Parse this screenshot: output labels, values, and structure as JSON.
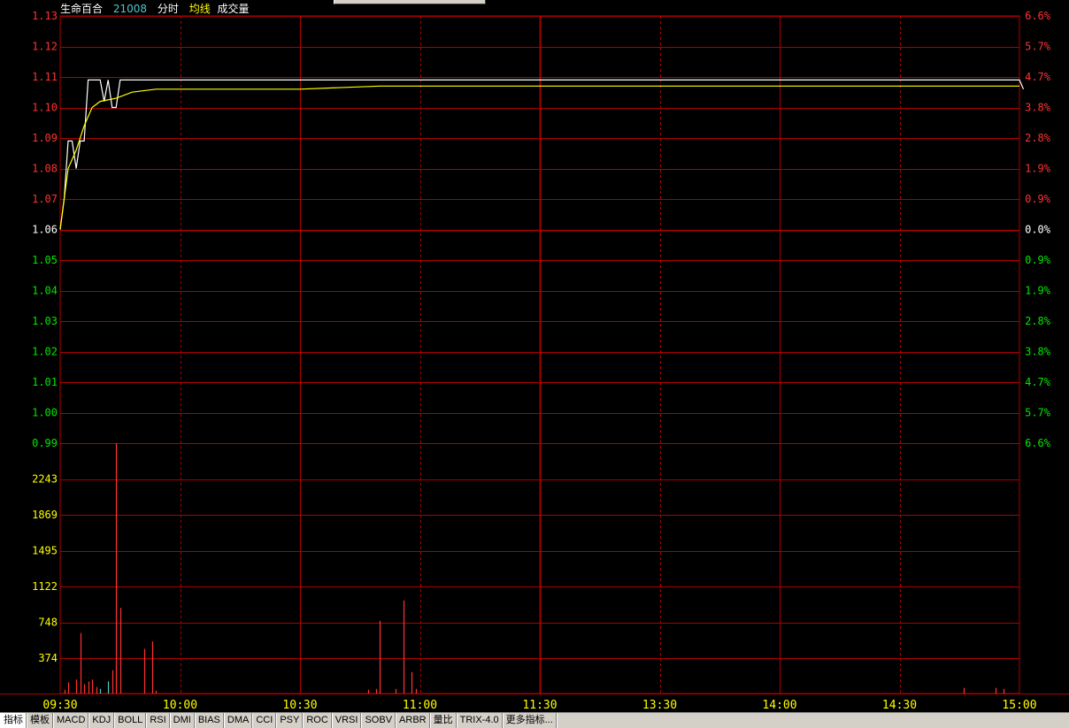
{
  "header": {
    "stock_name": "生命百合",
    "stock_code": "21008",
    "mode": "分时",
    "avg_label": "均线",
    "volume_label": "成交量"
  },
  "price_axis": {
    "labels": [
      "1.13",
      "1.12",
      "1.11",
      "1.10",
      "1.09",
      "1.08",
      "1.07",
      "1.06",
      "1.05",
      "1.04",
      "1.03",
      "1.02",
      "1.01",
      "1.00",
      "0.99"
    ],
    "base_price": 1.06,
    "min": 0.99,
    "max": 1.13
  },
  "pct_axis": {
    "labels": [
      "6.6%",
      "5.7%",
      "4.7%",
      "3.8%",
      "2.8%",
      "1.9%",
      "0.9%",
      "0.0%",
      "0.9%",
      "1.9%",
      "2.8%",
      "3.8%",
      "4.7%",
      "5.7%",
      "6.6%"
    ]
  },
  "volume_axis": {
    "labels": [
      "2243",
      "1869",
      "1495",
      "1122",
      "748",
      "374"
    ],
    "max": 2690
  },
  "time_axis": {
    "labels": [
      "09:30",
      "10:00",
      "10:30",
      "11:00",
      "11:30",
      "13:30",
      "14:00",
      "14:30",
      "15:00"
    ]
  },
  "colors": {
    "grid": "#b00000",
    "up": "#ff3232",
    "down": "#00e600",
    "flat": "#ffffff",
    "time_label": "#ffff00",
    "volume_label": "#ffff00",
    "price_line": "#ffffff",
    "avg_line": "#ffff00",
    "volume_up": "#ff3232",
    "volume_down": "#4ec9c9"
  },
  "chart_data": {
    "type": "line",
    "x_unit": "trading minutes since 09:30 (0-240)",
    "series": [
      {
        "name": "分时",
        "points": [
          [
            0,
            1.06
          ],
          [
            1,
            1.07
          ],
          [
            2,
            1.089
          ],
          [
            3,
            1.089
          ],
          [
            4,
            1.08
          ],
          [
            5,
            1.089
          ],
          [
            6,
            1.089
          ],
          [
            7,
            1.109
          ],
          [
            8,
            1.109
          ],
          [
            9,
            1.109
          ],
          [
            10,
            1.109
          ],
          [
            11,
            1.102
          ],
          [
            12,
            1.109
          ],
          [
            13,
            1.1
          ],
          [
            14,
            1.1
          ],
          [
            15,
            1.109
          ],
          [
            240,
            1.109
          ],
          [
            241,
            1.106
          ]
        ]
      },
      {
        "name": "均线",
        "points": [
          [
            0,
            1.06
          ],
          [
            2,
            1.08
          ],
          [
            4,
            1.086
          ],
          [
            6,
            1.094
          ],
          [
            8,
            1.1
          ],
          [
            10,
            1.102
          ],
          [
            14,
            1.103
          ],
          [
            18,
            1.105
          ],
          [
            24,
            1.106
          ],
          [
            60,
            1.106
          ],
          [
            80,
            1.107
          ],
          [
            120,
            1.107
          ],
          [
            240,
            1.107
          ]
        ]
      }
    ],
    "volume": {
      "bars": [
        [
          1,
          40,
          "up"
        ],
        [
          2,
          120,
          "up"
        ],
        [
          4,
          150,
          "up"
        ],
        [
          5,
          650,
          "up"
        ],
        [
          6,
          100,
          "up"
        ],
        [
          7,
          130,
          "up"
        ],
        [
          8,
          150,
          "up"
        ],
        [
          9,
          70,
          "up"
        ],
        [
          10,
          50,
          "down"
        ],
        [
          12,
          130,
          "down"
        ],
        [
          13,
          250,
          "up"
        ],
        [
          14,
          2690,
          "up"
        ],
        [
          15,
          920,
          "up"
        ],
        [
          21,
          480,
          "up"
        ],
        [
          23,
          560,
          "up"
        ],
        [
          24,
          30,
          "up"
        ],
        [
          77,
          40,
          "up"
        ],
        [
          79,
          50,
          "up"
        ],
        [
          80,
          780,
          "up"
        ],
        [
          84,
          50,
          "up"
        ],
        [
          86,
          1000,
          "up"
        ],
        [
          88,
          230,
          "up"
        ],
        [
          89,
          50,
          "up"
        ],
        [
          226,
          60,
          "up"
        ],
        [
          234,
          60,
          "up"
        ],
        [
          236,
          50,
          "up"
        ]
      ]
    }
  },
  "tabs": [
    "指标",
    "模板",
    "MACD",
    "KDJ",
    "BOLL",
    "RSI",
    "DMI",
    "BIAS",
    "DMA",
    "CCI",
    "PSY",
    "ROC",
    "VRSI",
    "SOBV",
    "ARBR",
    "量比",
    "TRIX-4.0",
    "更多指标..."
  ]
}
